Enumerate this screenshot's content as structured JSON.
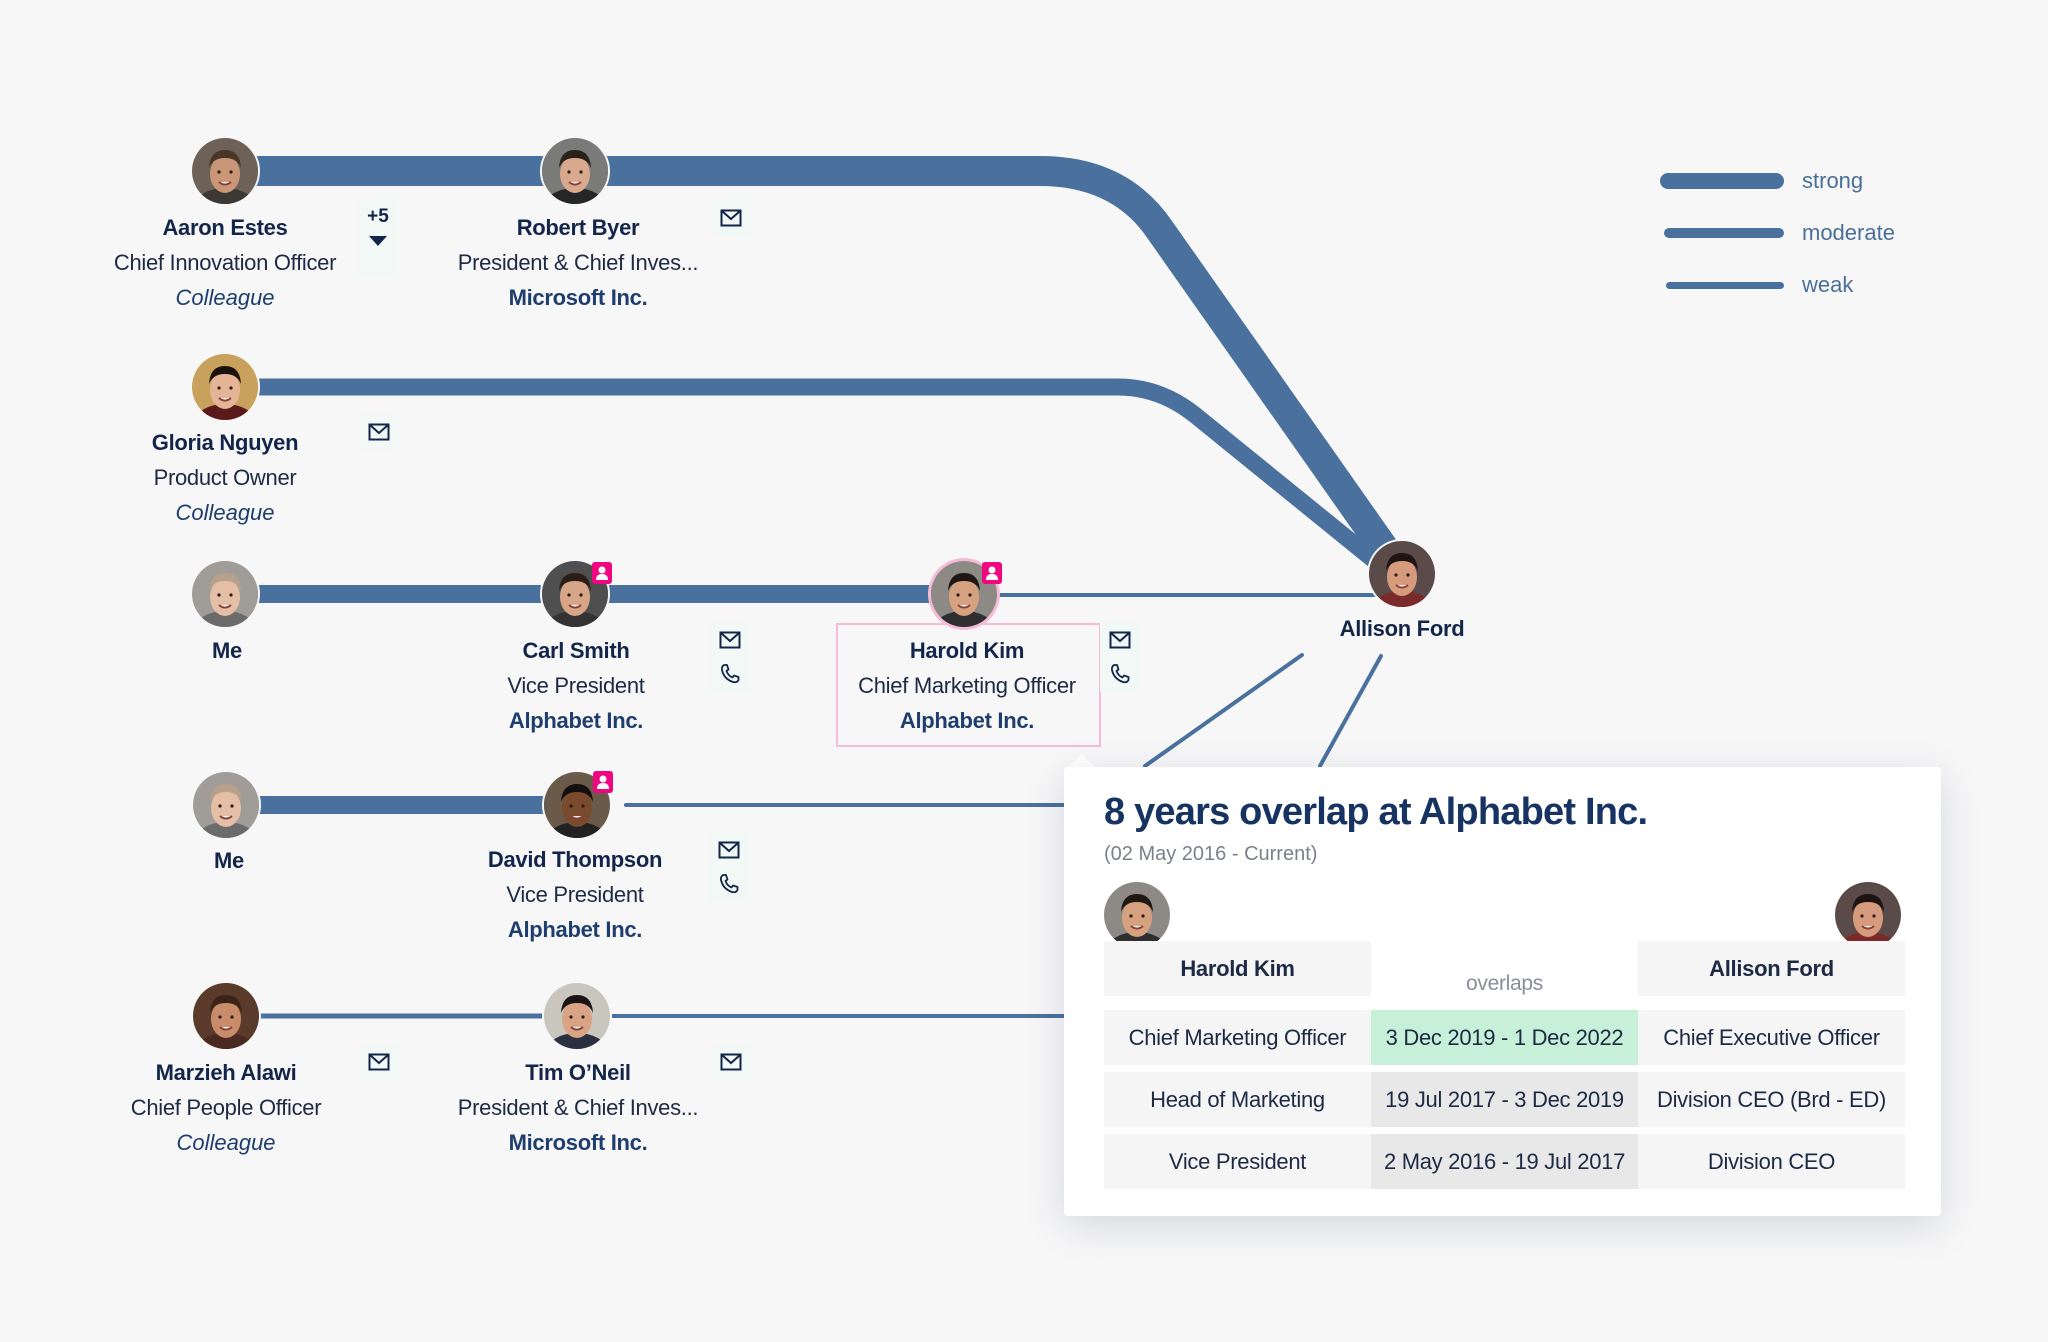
{
  "colors": {
    "link": "#4a719d",
    "badge": "#f0077f",
    "highlight_border": "#f6bcd7",
    "overlap_highlight": "#c7f0d9",
    "text_dark": "#13264a",
    "text_company": "#1f3e6e"
  },
  "legend": {
    "items": [
      {
        "label": "strong",
        "strength": "strong"
      },
      {
        "label": "moderate",
        "strength": "moderate"
      },
      {
        "label": "weak",
        "strength": "weak"
      }
    ]
  },
  "target": {
    "name": "Allison Ford",
    "avatar": "avatar-allison-ford"
  },
  "paths": [
    {
      "nodes": [
        {
          "name": "Aaron Estes",
          "title": "Chief Innovation Officer",
          "relation": "Colleague",
          "badge": false,
          "avatar": "avatar-aaron-estes"
        },
        {
          "name": "Robert Byer",
          "title": "President & Chief Inves...",
          "company": "Microsoft Inc.",
          "badge": false,
          "avatar": "avatar-robert-byer",
          "actions": [
            "mail-icon"
          ]
        }
      ],
      "more_count": "+5",
      "link_strengths": [
        "strong",
        "strong"
      ]
    },
    {
      "nodes": [
        {
          "name": "Gloria Nguyen",
          "title": "Product Owner",
          "relation": "Colleague",
          "badge": false,
          "avatar": "avatar-gloria-nguyen",
          "actions": [
            "mail-icon"
          ]
        }
      ],
      "link_strengths": [
        "moderate"
      ]
    },
    {
      "nodes": [
        {
          "name": "Me",
          "avatar": "avatar-me"
        },
        {
          "name": "Carl Smith",
          "title": "Vice President",
          "company": "Alphabet Inc.",
          "badge": true,
          "avatar": "avatar-carl-smith",
          "actions": [
            "mail-icon",
            "phone-icon"
          ]
        },
        {
          "name": "Harold Kim",
          "title": "Chief Marketing Officer",
          "company": "Alphabet Inc.",
          "badge": true,
          "selected": true,
          "avatar": "avatar-harold-kim",
          "actions": [
            "mail-icon",
            "phone-icon"
          ]
        }
      ],
      "link_strengths": [
        "strong",
        "strong",
        "weak"
      ]
    },
    {
      "nodes": [
        {
          "name": "Me",
          "avatar": "avatar-me"
        },
        {
          "name": "David Thompson",
          "title": "Vice President",
          "company": "Alphabet Inc.",
          "badge": true,
          "avatar": "avatar-david-thompson",
          "actions": [
            "mail-icon",
            "phone-icon"
          ]
        }
      ],
      "link_strengths": [
        "strong",
        "weak"
      ]
    },
    {
      "nodes": [
        {
          "name": "Marzieh Alawi",
          "title": "Chief People Officer",
          "relation": "Colleague",
          "badge": false,
          "avatar": "avatar-marzieh-alawi",
          "actions": [
            "mail-icon"
          ]
        },
        {
          "name": "Tim O’Neil",
          "title": "President & Chief Inves...",
          "company": "Microsoft Inc.",
          "badge": false,
          "avatar": "avatar-tim-oneil",
          "actions": [
            "mail-icon"
          ]
        }
      ],
      "link_strengths": [
        "weak",
        "weak"
      ]
    }
  ],
  "popup": {
    "title": "8 years overlap at Alphabet Inc.",
    "subtitle": "(02 May 2016 - Current)",
    "left_person": "Harold Kim",
    "right_person": "Allison Ford",
    "middle_header": "overlaps",
    "rows": [
      {
        "left": "Chief Marketing Officer",
        "period": "3 Dec 2019 - 1 Dec 2022",
        "right": "Chief Executive Officer",
        "highlight": true
      },
      {
        "left": "Head of Marketing",
        "period": "19 Jul 2017 - 3 Dec 2019",
        "right": "Division CEO (Brd - ED)",
        "highlight": false
      },
      {
        "left": "Vice President",
        "period": "2 May 2016 - 19 Jul 2017",
        "right": "Division CEO",
        "highlight": false
      }
    ]
  }
}
